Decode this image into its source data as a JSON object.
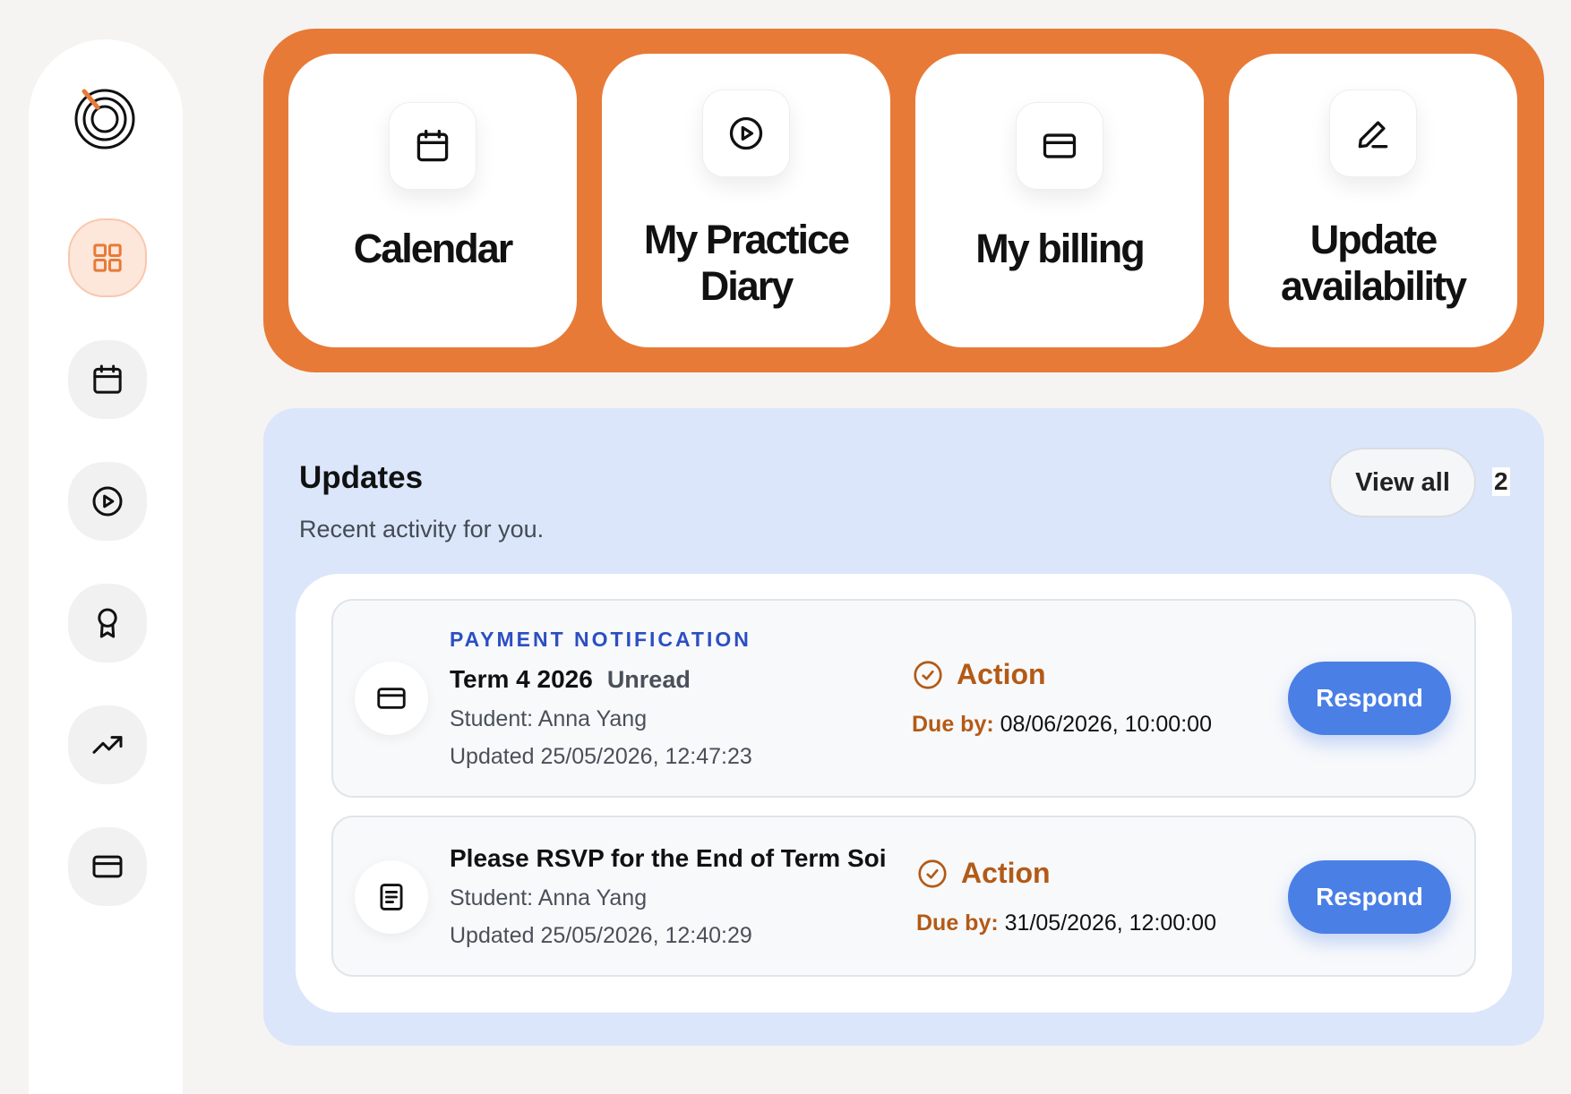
{
  "sidebar": {
    "logo": "concentric-logo",
    "items": [
      {
        "icon": "grid-icon",
        "active": true
      },
      {
        "icon": "calendar-icon",
        "active": false
      },
      {
        "icon": "play-circle-icon",
        "active": false
      },
      {
        "icon": "award-icon",
        "active": false
      },
      {
        "icon": "trending-up-icon",
        "active": false
      },
      {
        "icon": "credit-card-icon",
        "active": false
      }
    ]
  },
  "quick_links": [
    {
      "label": "Calendar",
      "icon": "calendar-icon"
    },
    {
      "label_lines": [
        "My Practice",
        "Diary"
      ],
      "icon": "play-circle-icon"
    },
    {
      "label": "My billing",
      "icon": "credit-card-icon"
    },
    {
      "label_lines": [
        "Update",
        "availability"
      ],
      "icon": "pencil-icon"
    }
  ],
  "updates": {
    "title": "Updates",
    "subtitle": "Recent activity for you.",
    "view_all": "View all",
    "count": "2",
    "items": [
      {
        "kind": "PAYMENT NOTIFICATION",
        "title": "Term 4 2026",
        "status": "Unread",
        "student": "Student: Anna Yang",
        "updated": "Updated 25/05/2026, 12:47:23",
        "action": "Action",
        "due_label": "Due by:",
        "due_value": "08/06/2026, 10:00:00",
        "button": "Respond",
        "icon": "credit-card-icon"
      },
      {
        "title": "Please RSVP for the End of Term Soi",
        "student": "Student: Anna Yang",
        "updated": "Updated 25/05/2026, 12:40:29",
        "action": "Action",
        "due_label": "Due by:",
        "due_value": "31/05/2026, 12:00:00",
        "button": "Respond",
        "icon": "document-icon"
      }
    ]
  },
  "colors": {
    "accent_orange": "#e87a37",
    "updates_bg": "#dbe6fa",
    "action_brown": "#b35a16",
    "primary_blue": "#4a7fe6",
    "kind_blue": "#2b4fc2"
  }
}
